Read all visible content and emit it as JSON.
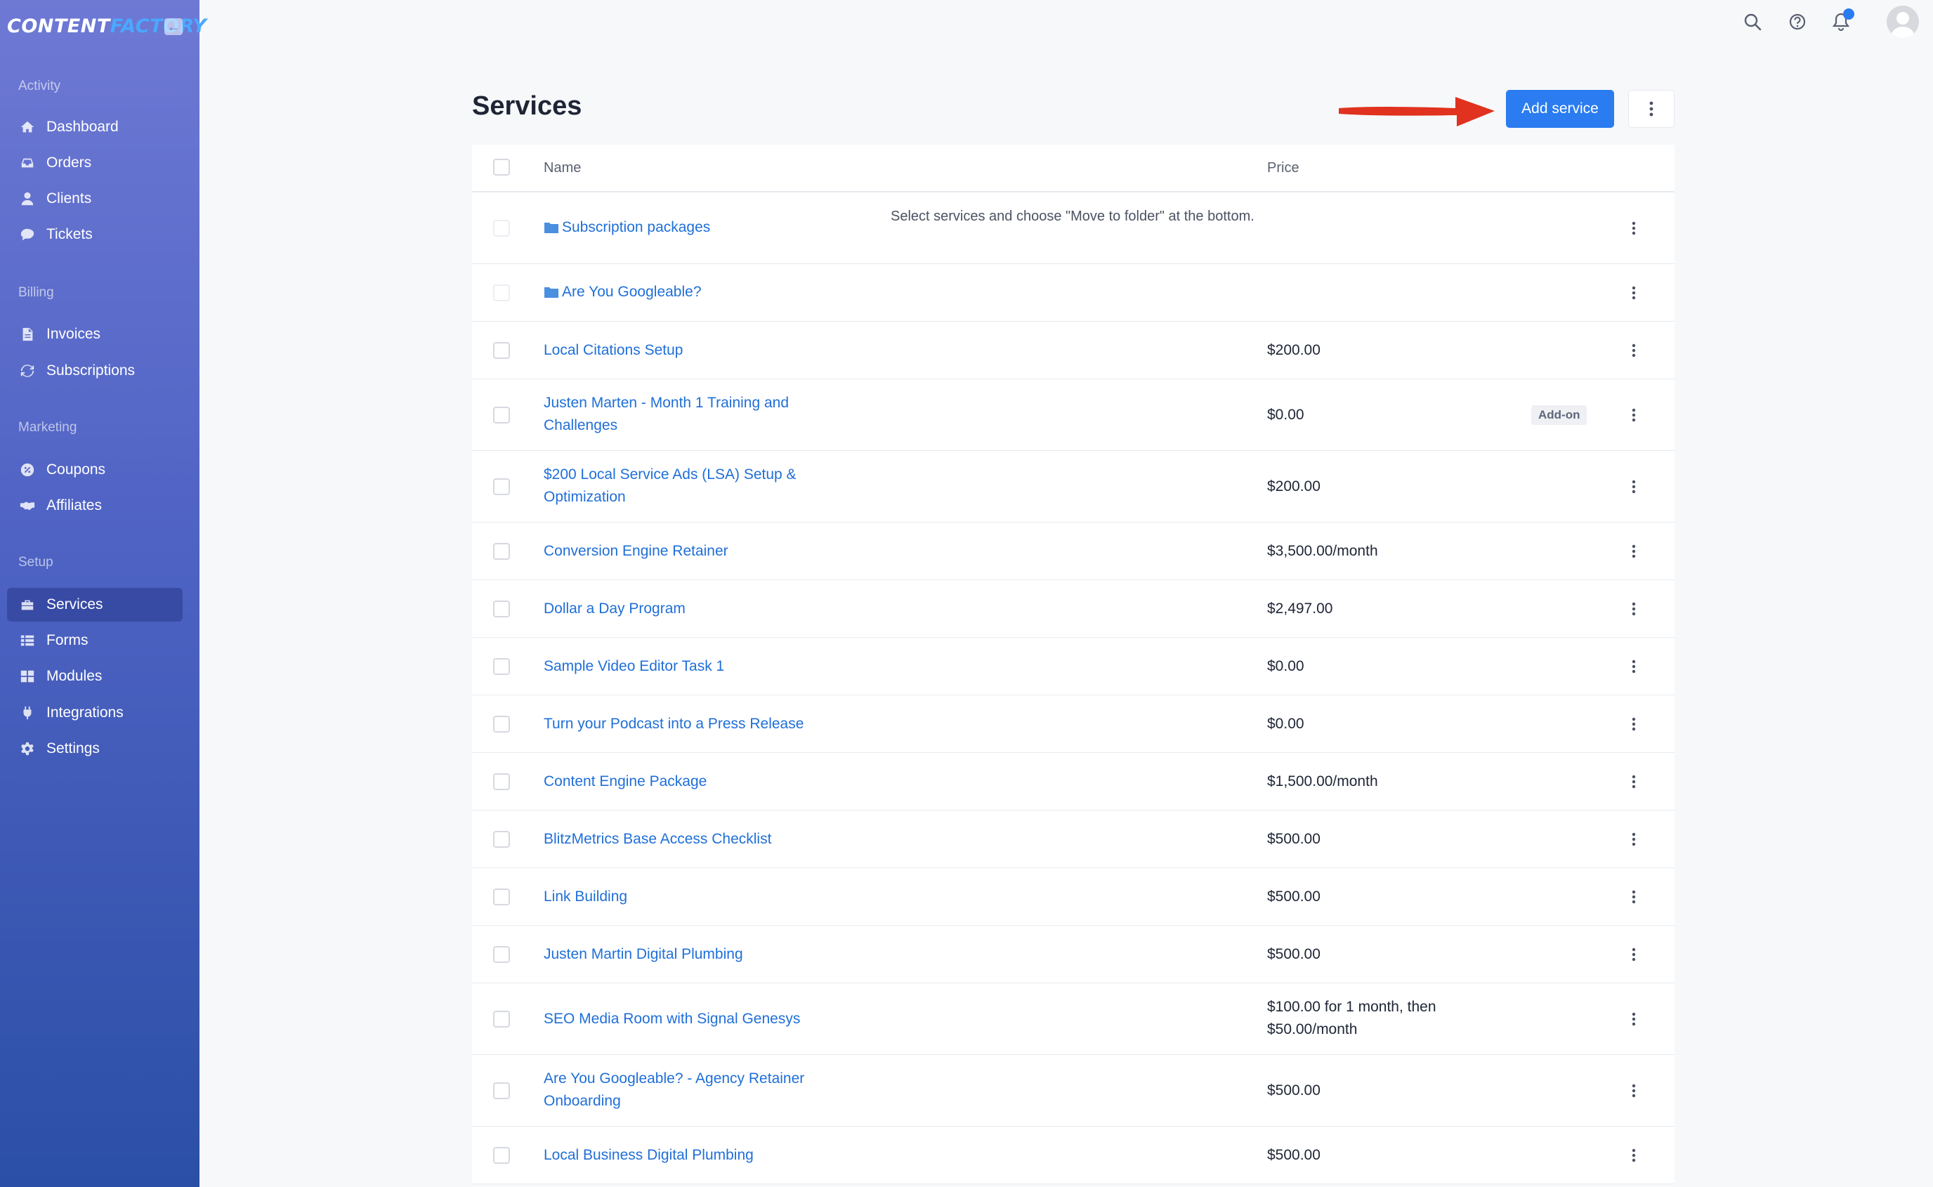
{
  "app": {
    "logo_word1": "CONTENT",
    "logo_word2": "FACTORY"
  },
  "sidebar": {
    "sections": [
      {
        "label": "Activity"
      },
      {
        "label": "Billing"
      },
      {
        "label": "Marketing"
      },
      {
        "label": "Setup"
      }
    ],
    "items": [
      {
        "label": "Dashboard",
        "icon": "home-icon"
      },
      {
        "label": "Orders",
        "icon": "inbox-icon"
      },
      {
        "label": "Clients",
        "icon": "user-icon"
      },
      {
        "label": "Tickets",
        "icon": "chat-bubble-icon"
      },
      {
        "label": "Invoices",
        "icon": "document-icon"
      },
      {
        "label": "Subscriptions",
        "icon": "refresh-icon"
      },
      {
        "label": "Coupons",
        "icon": "coupon-icon"
      },
      {
        "label": "Affiliates",
        "icon": "handshake-icon"
      },
      {
        "label": "Services",
        "icon": "briefcase-icon",
        "active": true
      },
      {
        "label": "Forms",
        "icon": "list-icon"
      },
      {
        "label": "Modules",
        "icon": "grid-icon"
      },
      {
        "label": "Integrations",
        "icon": "plug-icon"
      },
      {
        "label": "Settings",
        "icon": "gear-icon"
      }
    ]
  },
  "topbar": {
    "icons": [
      "search-icon",
      "help-icon",
      "bell-icon",
      "avatar"
    ]
  },
  "main": {
    "title": "Services",
    "add_button": "Add service",
    "columns": {
      "name": "Name",
      "price": "Price"
    },
    "folders": [
      {
        "name": "Subscription packages",
        "note": "Select services and choose \"Move to folder\" at the bottom."
      },
      {
        "name": "Are You Googleable?",
        "note": ""
      }
    ],
    "rows": [
      {
        "name": "Local Citations Setup",
        "price": "$200.00",
        "badge": ""
      },
      {
        "name": "Justen Marten - Month 1 Training and Challenges",
        "price": "$0.00",
        "badge": "Add-on"
      },
      {
        "name": "$200 Local Service Ads (LSA) Setup & Optimization",
        "price": "$200.00",
        "badge": ""
      },
      {
        "name": "Conversion Engine Retainer",
        "price": "$3,500.00/month",
        "badge": ""
      },
      {
        "name": "Dollar a Day Program",
        "price": "$2,497.00",
        "badge": ""
      },
      {
        "name": "Sample Video Editor Task 1",
        "price": "$0.00",
        "badge": ""
      },
      {
        "name": "Turn your Podcast into a Press Release",
        "price": "$0.00",
        "badge": ""
      },
      {
        "name": "Content Engine Package",
        "price": "$1,500.00/month",
        "badge": ""
      },
      {
        "name": "BlitzMetrics Base Access Checklist",
        "price": "$500.00",
        "badge": ""
      },
      {
        "name": "Link Building",
        "price": "$500.00",
        "badge": ""
      },
      {
        "name": "Justen Martin Digital Plumbing",
        "price": "$500.00",
        "badge": ""
      },
      {
        "name": "SEO Media Room with Signal Genesys",
        "price": "$100.00 for 1 month, then $50.00/month",
        "badge": ""
      },
      {
        "name": "Are You Googleable? - Agency Retainer Onboarding",
        "price": "$500.00",
        "badge": ""
      },
      {
        "name": "Local Business Digital Plumbing",
        "price": "$500.00",
        "badge": ""
      }
    ]
  },
  "colors": {
    "accent": "#2a7cf0",
    "link": "#1f6fd8",
    "sidebar_top": "#6e79d4",
    "sidebar_bottom": "#2b4fa6",
    "annotation_arrow": "#e0321e"
  }
}
